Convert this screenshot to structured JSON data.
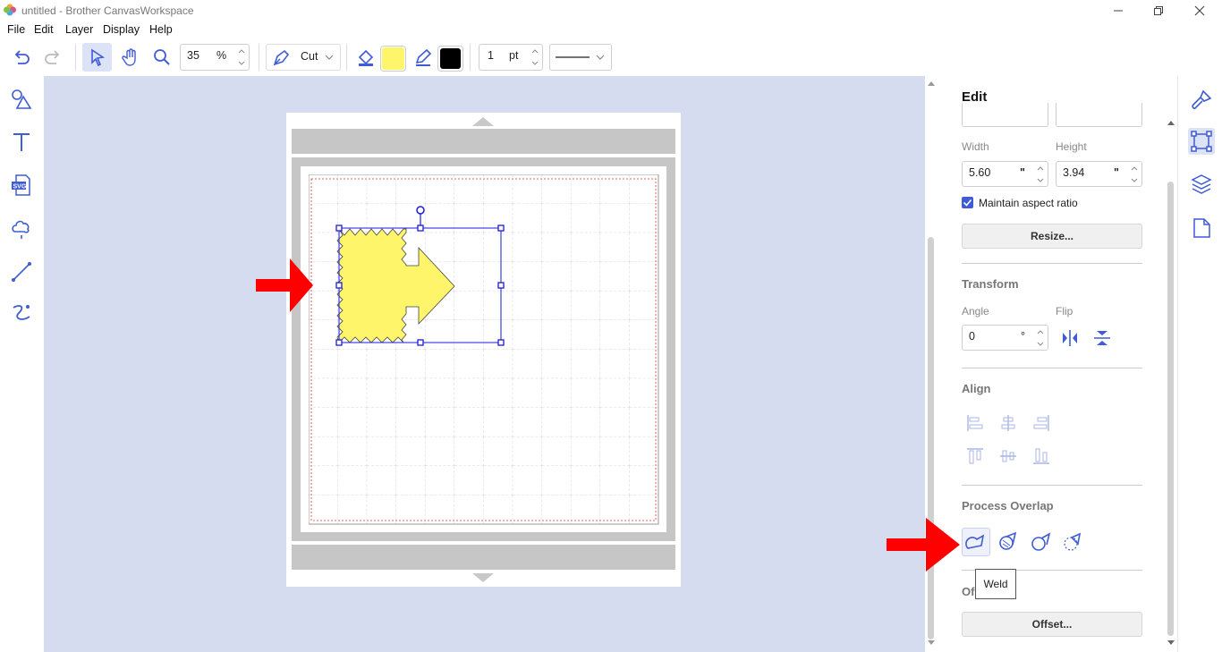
{
  "window": {
    "title": "untitled - Brother CanvasWorkspace"
  },
  "menu": [
    "File",
    "Edit",
    "Layer",
    "Display",
    "Help"
  ],
  "toolbar": {
    "zoom_value": "35",
    "zoom_unit": "%",
    "mode_label": "Cut",
    "fill_color": "#fff56b",
    "line_color": "#000000",
    "line_width_value": "1",
    "line_width_unit": "pt"
  },
  "edit_panel": {
    "title": "Edit",
    "size": {
      "width_label": "Width",
      "height_label": "Height",
      "width_value": "5.60",
      "width_unit": "\"",
      "height_value": "3.94",
      "height_unit": "\"",
      "maintain_aspect_label": "Maintain aspect ratio",
      "maintain_aspect_checked": true,
      "resize_button": "Resize..."
    },
    "transform": {
      "title": "Transform",
      "angle_label": "Angle",
      "angle_value": "0",
      "angle_unit": "°",
      "flip_label": "Flip"
    },
    "align": {
      "title": "Align"
    },
    "process_overlap": {
      "title": "Process Overlap",
      "tooltip": "Weld"
    },
    "offset": {
      "title_partial": "Of",
      "button": "Offset..."
    }
  },
  "colors": {
    "accent": "#3f5bd6",
    "canvas_bg": "#d5dcf0",
    "shape_fill": "#fff56b",
    "arrow_red": "#ff0000",
    "selection": "#1a1ad6"
  }
}
